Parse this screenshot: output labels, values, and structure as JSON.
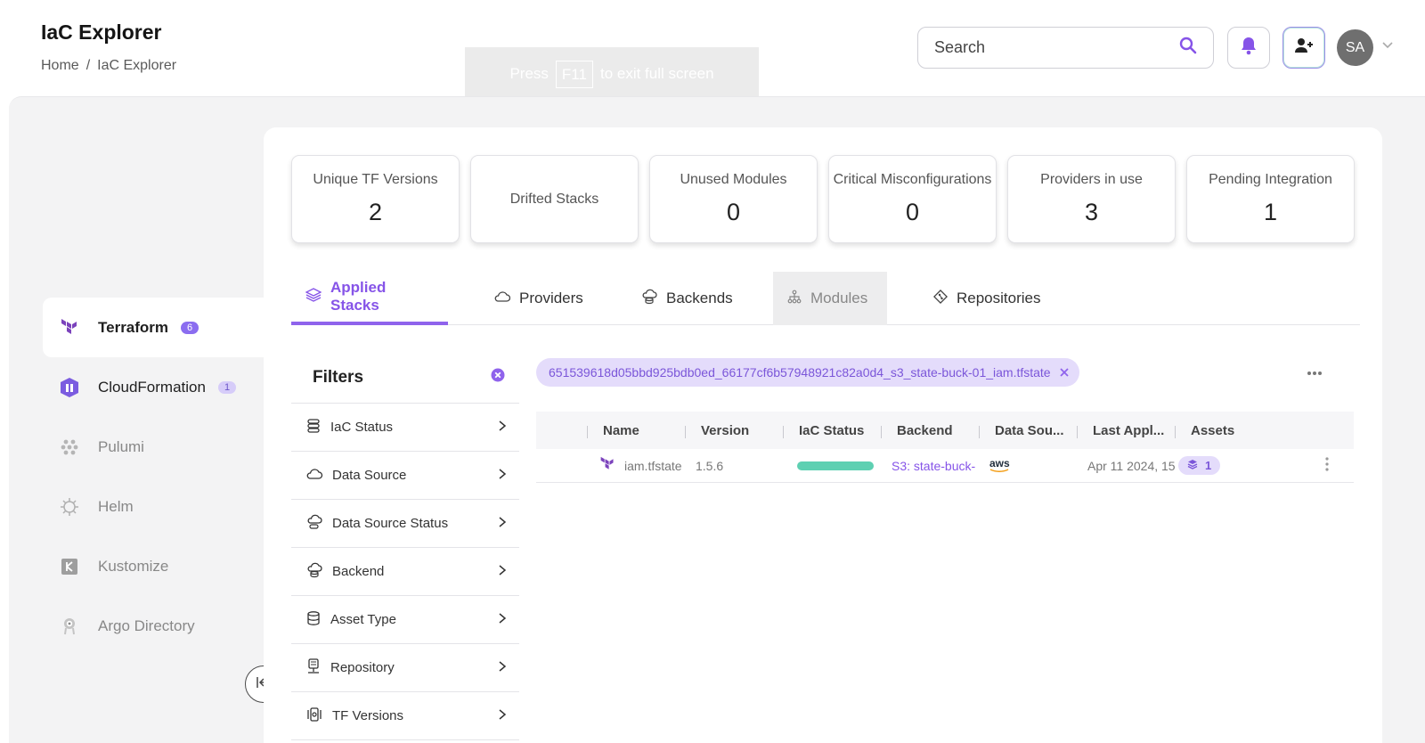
{
  "header": {
    "title": "IaC Explorer",
    "breadcrumb": [
      "Home",
      "IaC Explorer"
    ],
    "breadcrumb_sep": "/",
    "fullscreen_toast": {
      "prefix": "Press",
      "key": "F11",
      "suffix": "to exit full screen"
    },
    "search_placeholder": "Search",
    "avatar_initials": "SA"
  },
  "leftnav": {
    "items": [
      {
        "label": "Terraform",
        "badge": "6",
        "icon": "terraform-icon"
      },
      {
        "label": "CloudFormation",
        "badge": "1",
        "icon": "cloudformation-icon"
      },
      {
        "label": "Pulumi",
        "icon": "pulumi-icon"
      },
      {
        "label": "Helm",
        "icon": "helm-icon"
      },
      {
        "label": "Kustomize",
        "icon": "kustomize-icon"
      },
      {
        "label": "Argo Directory",
        "icon": "argo-icon"
      }
    ]
  },
  "stats": [
    {
      "label": "Unique TF Versions",
      "value": "2"
    },
    {
      "label": "Drifted Stacks",
      "value": ""
    },
    {
      "label": "Unused Modules",
      "value": "0"
    },
    {
      "label": "Critical Misconfigurations",
      "value": "0"
    },
    {
      "label": "Providers in use",
      "value": "3"
    },
    {
      "label": "Pending Integration",
      "value": "1"
    }
  ],
  "tabs": [
    {
      "label": "Applied Stacks",
      "icon": "layers-icon"
    },
    {
      "label": "Providers",
      "icon": "cloud-icon"
    },
    {
      "label": "Backends",
      "icon": "cloud-database-icon"
    },
    {
      "label": "Modules",
      "icon": "hierarchy-icon"
    },
    {
      "label": "Repositories",
      "icon": "git-icon"
    }
  ],
  "filters": {
    "title": "Filters",
    "items": [
      "IaC Status",
      "Data Source",
      "Data Source Status",
      "Backend",
      "Asset Type",
      "Repository",
      "TF Versions"
    ]
  },
  "chip": {
    "label": "651539618d05bbd925bdb0ed_66177cf6b57948921c82a0d4_s3_state-buck-01_iam.tfstate"
  },
  "table": {
    "columns": [
      "Name",
      "Version",
      "IaC Status",
      "Backend",
      "Data Sou...",
      "Last Appl...",
      "Assets"
    ],
    "rows": [
      {
        "name": "iam.tfstate",
        "version": "1.5.6",
        "iac_status_color": "#5ed0b2",
        "backend": "S3: state-buck-",
        "data_source": "aws",
        "last_applied": "Apr 11 2024, 15",
        "assets": "1"
      }
    ]
  },
  "colors": {
    "accent": "#8654e8",
    "status_ok": "#5ed0b2"
  }
}
